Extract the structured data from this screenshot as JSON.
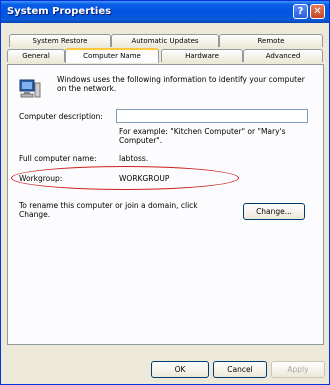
{
  "window": {
    "title": "System Properties",
    "help_glyph": "?",
    "close_glyph": "✕"
  },
  "tabs": {
    "row_top": [
      "System Restore",
      "Automatic Updates",
      "Remote"
    ],
    "row_bottom": [
      "General",
      "Computer Name",
      "Hardware",
      "Advanced"
    ],
    "active": "Computer Name"
  },
  "content": {
    "intro": "Windows uses the following information to identify your computer on the network.",
    "description_label": "Computer description:",
    "description_value": "",
    "example": "For example: \"Kitchen Computer\" or \"Mary's Computer\".",
    "full_name_label": "Full computer name:",
    "full_name_value": "labtoss.",
    "workgroup_label": "Workgroup:",
    "workgroup_value": "WORKGROUP",
    "rename_text": "To rename this computer or join a domain, click Change.",
    "change_label": "Change..."
  },
  "footer": {
    "ok": "OK",
    "cancel": "Cancel",
    "apply": "Apply"
  },
  "colors": {
    "titlebar": "#0054e3",
    "highlight": "#cc2020"
  }
}
